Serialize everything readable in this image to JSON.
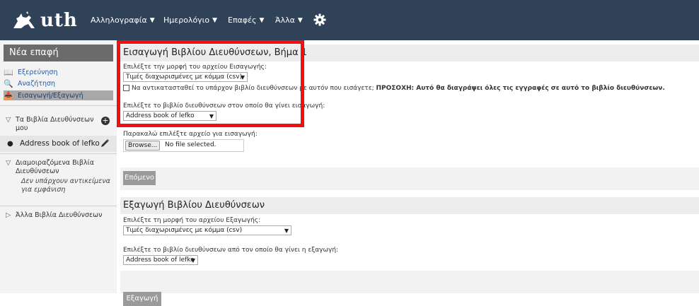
{
  "header": {
    "logo_text": "uth",
    "menu": [
      {
        "label": "Αλληλογραφία",
        "caret": "▼"
      },
      {
        "label": "Ημερολόγιο",
        "caret": "▼"
      },
      {
        "label": "Επαφές",
        "caret": "▼"
      },
      {
        "label": "Άλλα",
        "caret": "▼"
      }
    ],
    "gear_icon": "gear-icon"
  },
  "sidebar": {
    "new_contact": "Νέα επαφή",
    "links": [
      {
        "label": "Εξερεύνηση",
        "icon": "📖"
      },
      {
        "label": "Αναζήτηση",
        "icon": "🔍"
      },
      {
        "label": "Εισαγωγή/Εξαγωγή",
        "icon": "📥"
      }
    ],
    "my_books": {
      "line1": "Τα Βιβλία Διευθύνσεων",
      "line2": "μου",
      "tri": "▽",
      "plus": "+"
    },
    "current_book": {
      "label": "Address book of lefko",
      "dot": "●"
    },
    "shared": {
      "line1": "Διαμοιραζόμενα Βιβλία",
      "line2": "Διευθύνσεων",
      "tri": "▽",
      "empty1": "Δεν υπάρχουν αντικείμενα",
      "empty2": "για εμφάνιση"
    },
    "other": {
      "label": "Άλλα Βιβλία Διευθύνσεων",
      "tri": "▷"
    }
  },
  "import": {
    "title": "Εισαγωγή Βιβλίου Διευθύνσεων, Βήμα 1",
    "format_label": "Επιλέξτε την μορφή του αρχείου Εισαγωγής:",
    "format_value": "Τιμές διαχωρισμένες με κόμμα (csv)",
    "replace_label": "Να αντικατασταθεί το υπάρχον βιβλίο διευθύνσεων με αυτόν που εισάγετε;",
    "warning": "ΠΡΟΣΟΧΗ: Αυτό θα διαγράψει όλες τις εγγραφές σε αυτό το βιβλίο διευθύνσεων.",
    "target_label": "Επιλέξτε το βιβλίο διευθύνσεων στον οποίο θα γίνει εισαγωγή:",
    "target_value": "Address book of lefko",
    "file_label": "Παρακαλώ επιλέξτε αρχείο για εισαγωγή:",
    "browse": "Browse...",
    "no_file": "No file selected.",
    "next_button": "Επόμενο"
  },
  "export": {
    "title": "Εξαγωγή Βιβλίου Διευθύνσεων",
    "format_label": "Επιλέξτε τη μορφή του αρχείου Εξαγωγής:",
    "format_value": "Τιμές διαχωρισμένες με κόμμα (csv)",
    "source_label": "Επιλέξτε το βιβλίο διευθύνσεων από τον οποίο θα γίνει η εξαγωγή:",
    "source_value": "Address book of lefko",
    "export_button": "Εξαγωγή"
  },
  "colors": {
    "topbar": "#2f4258",
    "highlight": "#ee1111"
  }
}
